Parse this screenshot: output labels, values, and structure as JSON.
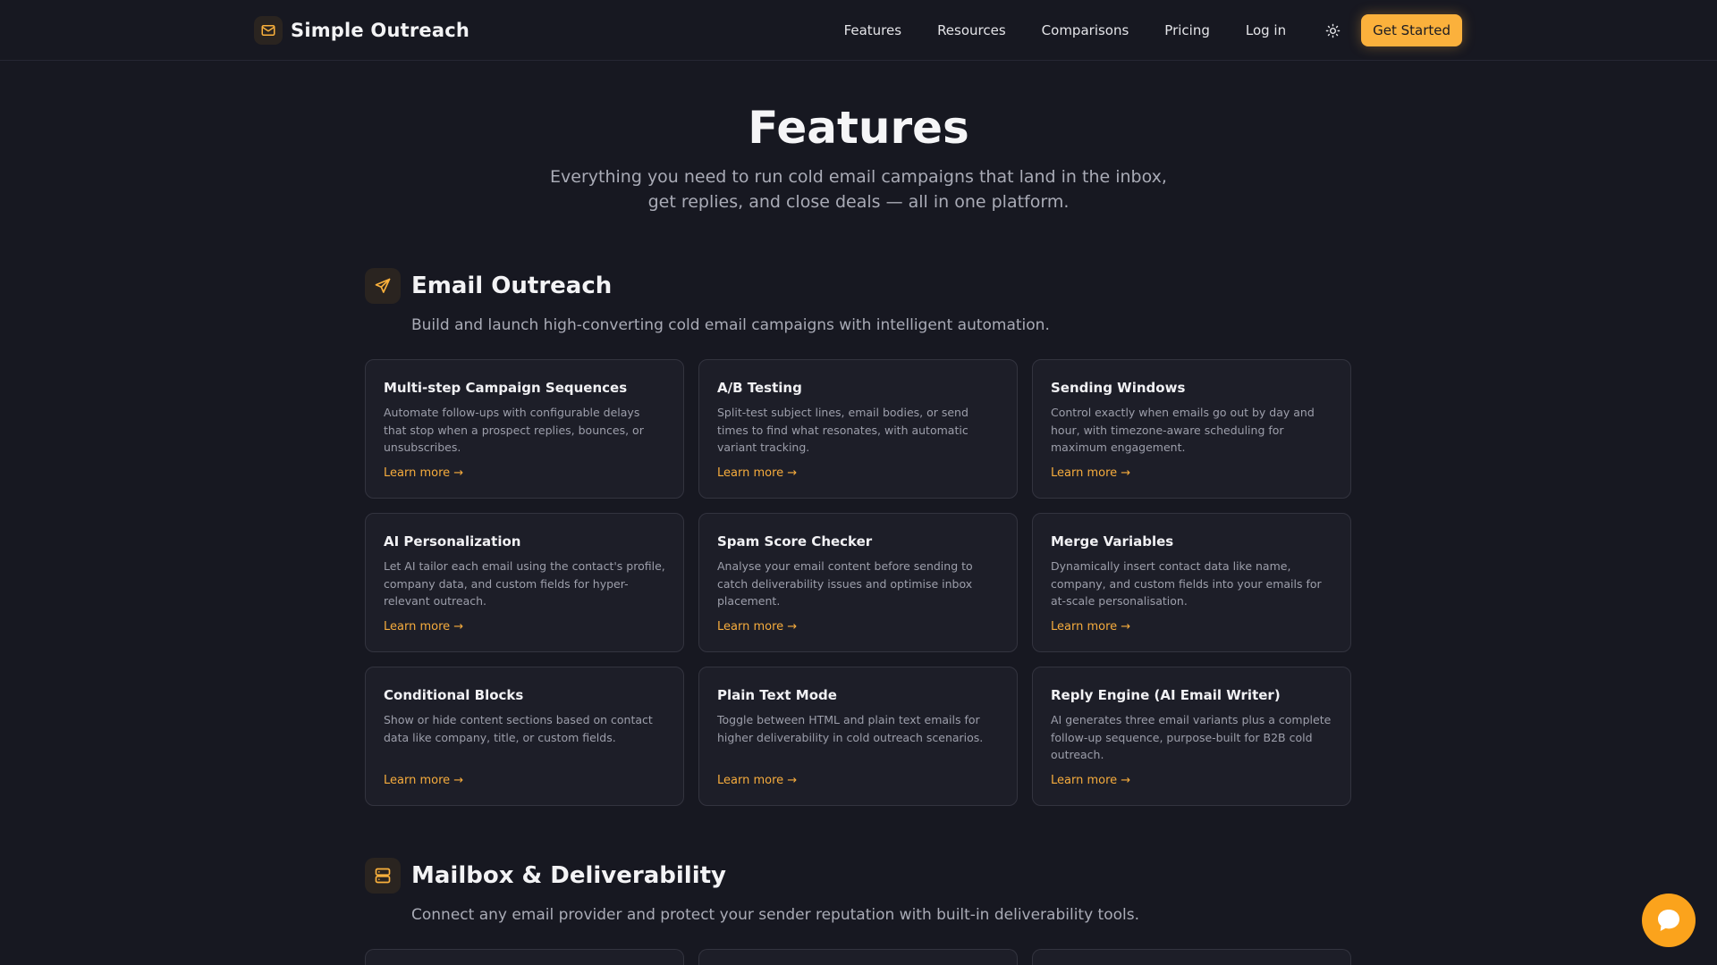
{
  "header": {
    "brand_name": "Simple Outreach",
    "brand_icon": "mail-icon",
    "nav": [
      "Features",
      "Resources",
      "Comparisons",
      "Pricing",
      "Log in"
    ],
    "theme_icon": "sun-icon",
    "cta_label": "Get Started"
  },
  "hero": {
    "title": "Features",
    "subtitle": "Everything you need to run cold email campaigns that land in the inbox, get replies, and close deals — all in one platform."
  },
  "sections": [
    {
      "icon": "send-icon",
      "title": "Email Outreach",
      "description": "Build and launch high-converting cold email campaigns with intelligent automation.",
      "cards": [
        {
          "title": "Multi-step Campaign Sequences",
          "description": "Automate follow-ups with configurable delays that stop when a prospect replies, bounces, or unsubscribes.",
          "link": "Learn more →"
        },
        {
          "title": "A/B Testing",
          "description": "Split-test subject lines, email bodies, or send times to find what resonates, with automatic variant tracking.",
          "link": "Learn more →"
        },
        {
          "title": "Sending Windows",
          "description": "Control exactly when emails go out by day and hour, with timezone-aware scheduling for maximum engagement.",
          "link": "Learn more →"
        },
        {
          "title": "AI Personalization",
          "description": "Let AI tailor each email using the contact's profile, company data, and custom fields for hyper-relevant outreach.",
          "link": "Learn more →"
        },
        {
          "title": "Spam Score Checker",
          "description": "Analyse your email content before sending to catch deliverability issues and optimise inbox placement.",
          "link": "Learn more →"
        },
        {
          "title": "Merge Variables",
          "description": "Dynamically insert contact data like name, company, and custom fields into your emails for at-scale personalisation.",
          "link": "Learn more →"
        },
        {
          "title": "Conditional Blocks",
          "description": "Show or hide content sections based on contact data like company, title, or custom fields.",
          "link": "Learn more →"
        },
        {
          "title": "Plain Text Mode",
          "description": "Toggle between HTML and plain text emails for higher deliverability in cold outreach scenarios.",
          "link": "Learn more →"
        },
        {
          "title": "Reply Engine (AI Email Writer)",
          "description": "AI generates three email variants plus a complete follow-up sequence, purpose-built for B2B cold outreach.",
          "link": "Learn more →"
        }
      ]
    },
    {
      "icon": "server-icon",
      "title": "Mailbox & Deliverability",
      "description": "Connect any email provider and protect your sender reputation with built-in deliverability tools."
    }
  ],
  "chat_icon": "chat-bubble-icon",
  "colors": {
    "accent": "#fbb13c",
    "background": "#171821",
    "card": "#1d1e28",
    "border": "#33343f"
  }
}
